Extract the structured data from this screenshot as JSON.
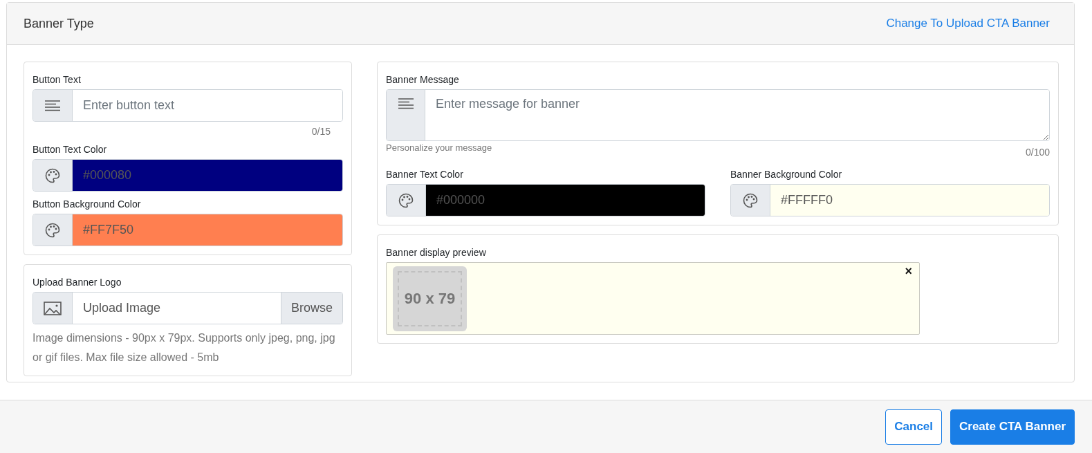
{
  "header": {
    "title": "Banner Type",
    "link": "Change To Upload CTA Banner"
  },
  "button_text": {
    "label": "Button Text",
    "placeholder": "Enter button text",
    "counter": "0/15"
  },
  "button_text_color": {
    "label": "Button Text Color",
    "value": "#000080",
    "color": "#000080"
  },
  "button_background_color": {
    "label": "Button Background Color",
    "value": "#FF7F50",
    "color": "#ff7f50"
  },
  "upload": {
    "label": "Upload Banner Logo",
    "placeholder": "Upload Image",
    "button": "Browse",
    "help": "Image dimensions - 90px x 79px. Supports only jpeg, png, jpg or gif files. Max file size allowed - 5mb"
  },
  "banner_message": {
    "label": "Banner Message",
    "placeholder": "Enter message for banner",
    "hint": "Personalize your message",
    "counter": "0/100"
  },
  "banner_text_color": {
    "label": "Banner Text Color",
    "value": "#000000",
    "color": "#000000"
  },
  "banner_background_color": {
    "label": "Banner Background Color",
    "value": "#FFFFF0",
    "color": "#fffff0"
  },
  "preview": {
    "label": "Banner display preview",
    "image_text": "90 x 79",
    "close": "×"
  },
  "footer": {
    "buttons": [
      {
        "label": "Cancel",
        "kind": "secondary"
      },
      {
        "label": "Create CTA Banner",
        "kind": "primary"
      }
    ]
  }
}
